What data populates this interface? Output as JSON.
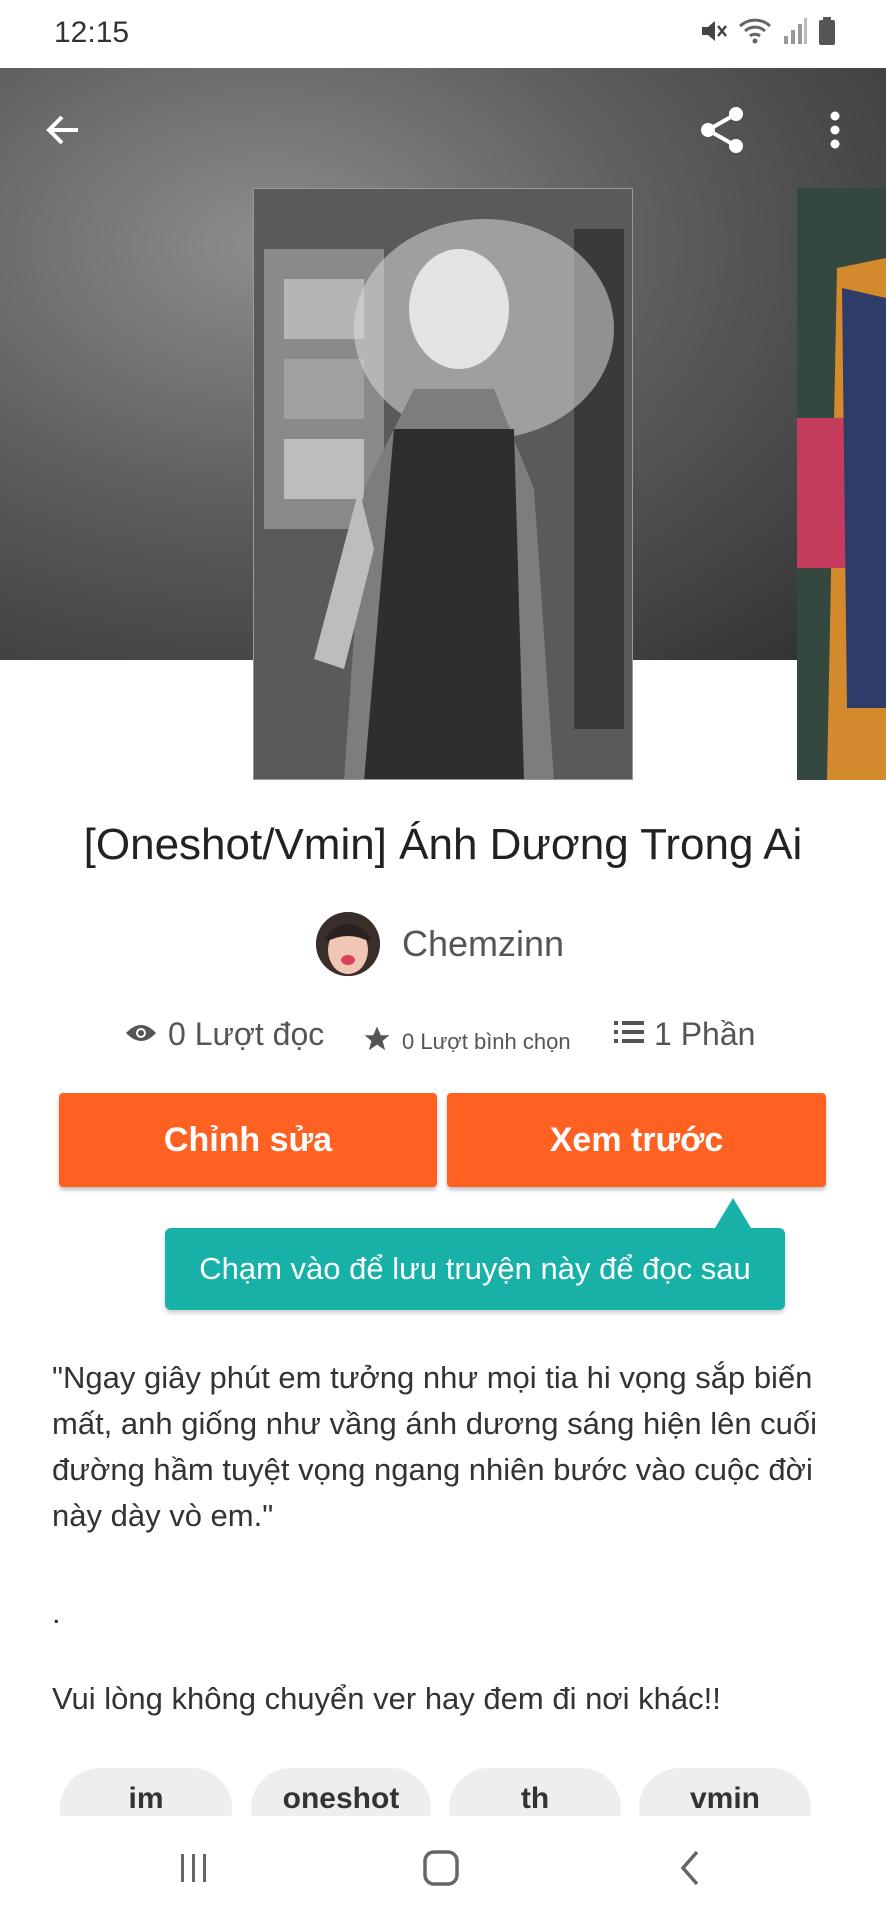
{
  "status_bar": {
    "time": "12:15",
    "icons": [
      "mute-icon",
      "wifi-icon",
      "signal-icon",
      "battery-icon"
    ]
  },
  "app_bar": {
    "icons": [
      "back-arrow-icon",
      "share-icon",
      "more-vert-icon"
    ]
  },
  "story": {
    "title": "[Oneshot/Vmin] Ánh Dương Trong Ai",
    "author": "Chemzinn",
    "stats": {
      "reads": "0 Lượt đọc",
      "votes": "0 Lượt bình chọn",
      "parts": "1 Phần"
    }
  },
  "buttons": {
    "edit_label": "Chỉnh sửa",
    "preview_label": "Xem trước"
  },
  "tooltip": {
    "text": "Chạm vào để lưu truyện này để đọc sau"
  },
  "description": {
    "quote": "\"Ngay giây phút em tưởng như mọi tia hi vọng sắp biến mất, anh giống như vầng ánh dương sáng hiện lên cuối đường hầm tuyệt vọng ngang nhiên bước vào cuộc đời này dày vò em.\"",
    "separator": ".",
    "note": "Vui lòng không chuyển ver hay đem đi nơi khác!!"
  },
  "tags": [
    "im",
    "oneshot",
    "th",
    "vmin"
  ],
  "colors": {
    "accent_orange": "#ff6122",
    "tooltip_teal": "#18b1a8"
  },
  "nav_bar": {
    "icons": [
      "recents-icon",
      "home-icon",
      "back-icon"
    ]
  }
}
